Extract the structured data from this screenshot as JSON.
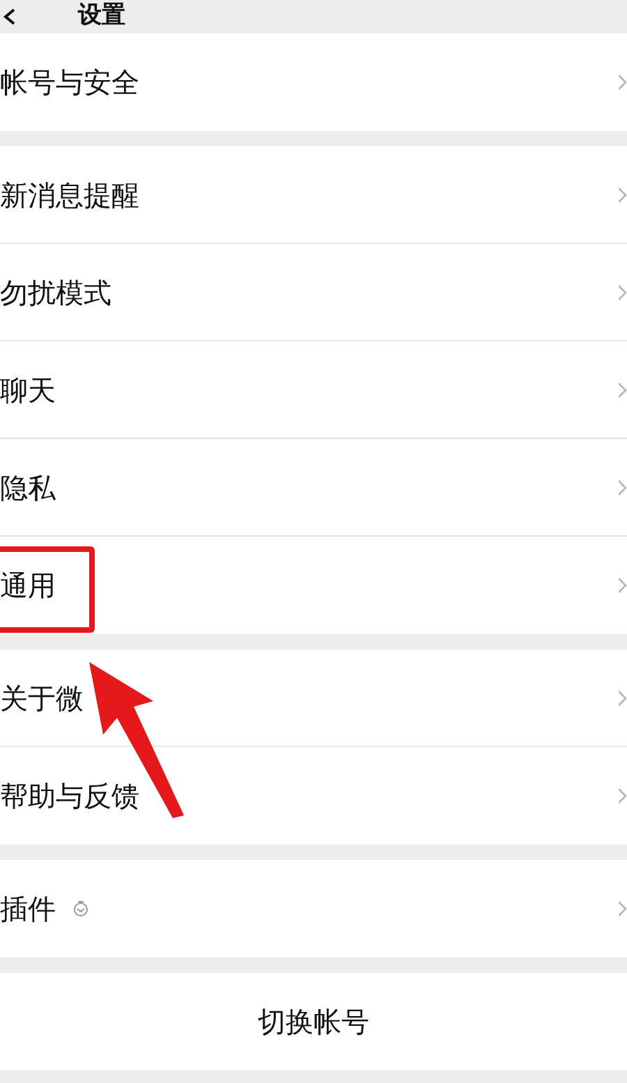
{
  "header": {
    "title": "设置"
  },
  "groups": [
    {
      "items": [
        {
          "label": "帐号与安全",
          "kind": "plain"
        }
      ]
    },
    {
      "items": [
        {
          "label": "新消息提醒",
          "kind": "plain"
        },
        {
          "label": "勿扰模式",
          "kind": "plain"
        },
        {
          "label": "聊天",
          "kind": "plain"
        },
        {
          "label": "隐私",
          "kind": "plain"
        },
        {
          "label": "通用",
          "kind": "plain"
        }
      ]
    },
    {
      "items": [
        {
          "label": "关于微",
          "kind": "plain"
        },
        {
          "label": "帮助与反馈",
          "kind": "plain"
        }
      ]
    },
    {
      "items": [
        {
          "label": "插件",
          "kind": "badge"
        }
      ]
    }
  ],
  "switch_button": "切换帐号"
}
